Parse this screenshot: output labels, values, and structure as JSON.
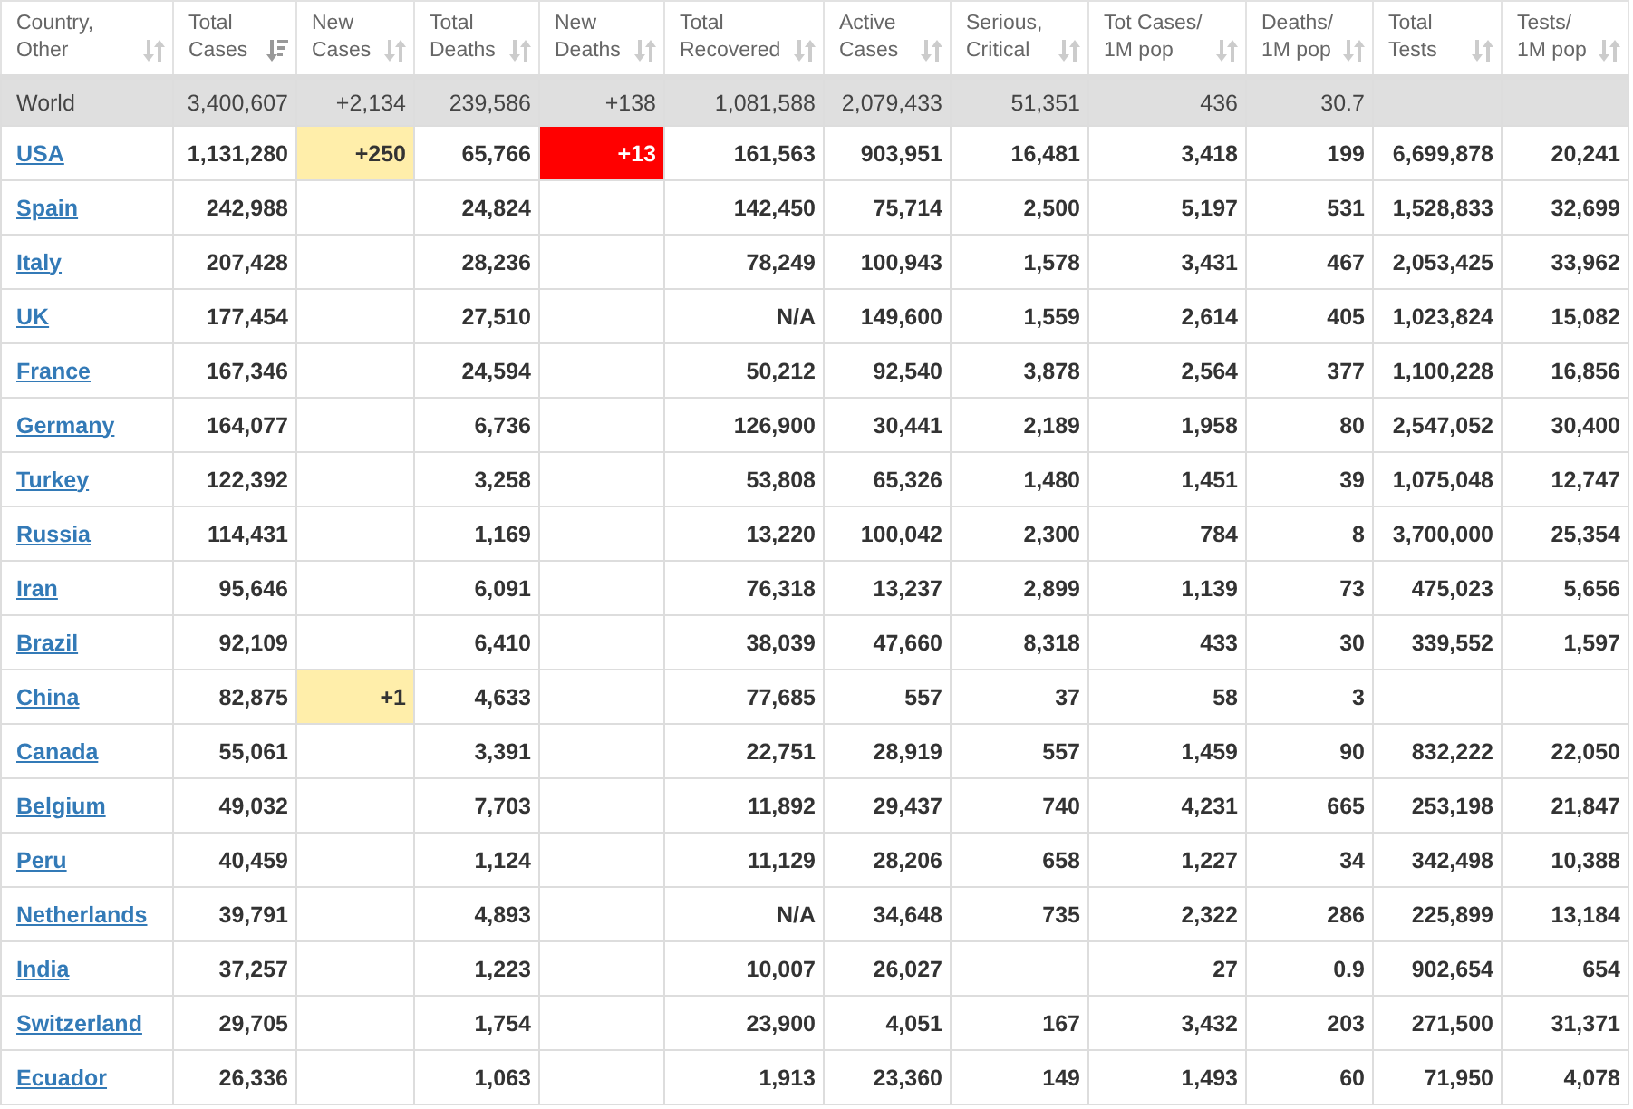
{
  "columns": [
    {
      "label": "Country,\nOther",
      "sorted": false
    },
    {
      "label": "Total\nCases",
      "sorted": true
    },
    {
      "label": "New\nCases",
      "sorted": false
    },
    {
      "label": "Total\nDeaths",
      "sorted": false
    },
    {
      "label": "New\nDeaths",
      "sorted": false
    },
    {
      "label": "Total\nRecovered",
      "sorted": false
    },
    {
      "label": "Active\nCases",
      "sorted": false
    },
    {
      "label": "Serious,\nCritical",
      "sorted": false
    },
    {
      "label": "Tot Cases/\n1M pop",
      "sorted": false
    },
    {
      "label": "Deaths/\n1M pop",
      "sorted": false
    },
    {
      "label": "Total\nTests",
      "sorted": false
    },
    {
      "label": "Tests/\n1M pop",
      "sorted": false
    }
  ],
  "world": {
    "country": "World",
    "total_cases": "3,400,607",
    "new_cases": "+2,134",
    "total_deaths": "239,586",
    "new_deaths": "+138",
    "total_recovered": "1,081,588",
    "active_cases": "2,079,433",
    "serious_critical": "51,351",
    "cases_per_1m": "436",
    "deaths_per_1m": "30.7"
  },
  "rows": [
    {
      "country": "USA",
      "total_cases": "1,131,280",
      "new_cases": "+250",
      "total_deaths": "65,766",
      "new_deaths": "+13",
      "total_recovered": "161,563",
      "active_cases": "903,951",
      "serious_critical": "16,481",
      "cases_per_1m": "3,418",
      "deaths_per_1m": "199",
      "total_tests": "6,699,878",
      "tests_per_1m": "20,241"
    },
    {
      "country": "Spain",
      "total_cases": "242,988",
      "total_deaths": "24,824",
      "total_recovered": "142,450",
      "active_cases": "75,714",
      "serious_critical": "2,500",
      "cases_per_1m": "5,197",
      "deaths_per_1m": "531",
      "total_tests": "1,528,833",
      "tests_per_1m": "32,699"
    },
    {
      "country": "Italy",
      "total_cases": "207,428",
      "total_deaths": "28,236",
      "total_recovered": "78,249",
      "active_cases": "100,943",
      "serious_critical": "1,578",
      "cases_per_1m": "3,431",
      "deaths_per_1m": "467",
      "total_tests": "2,053,425",
      "tests_per_1m": "33,962"
    },
    {
      "country": "UK",
      "total_cases": "177,454",
      "total_deaths": "27,510",
      "total_recovered": "N/A",
      "active_cases": "149,600",
      "serious_critical": "1,559",
      "cases_per_1m": "2,614",
      "deaths_per_1m": "405",
      "total_tests": "1,023,824",
      "tests_per_1m": "15,082"
    },
    {
      "country": "France",
      "total_cases": "167,346",
      "total_deaths": "24,594",
      "total_recovered": "50,212",
      "active_cases": "92,540",
      "serious_critical": "3,878",
      "cases_per_1m": "2,564",
      "deaths_per_1m": "377",
      "total_tests": "1,100,228",
      "tests_per_1m": "16,856"
    },
    {
      "country": "Germany",
      "total_cases": "164,077",
      "total_deaths": "6,736",
      "total_recovered": "126,900",
      "active_cases": "30,441",
      "serious_critical": "2,189",
      "cases_per_1m": "1,958",
      "deaths_per_1m": "80",
      "total_tests": "2,547,052",
      "tests_per_1m": "30,400"
    },
    {
      "country": "Turkey",
      "total_cases": "122,392",
      "total_deaths": "3,258",
      "total_recovered": "53,808",
      "active_cases": "65,326",
      "serious_critical": "1,480",
      "cases_per_1m": "1,451",
      "deaths_per_1m": "39",
      "total_tests": "1,075,048",
      "tests_per_1m": "12,747"
    },
    {
      "country": "Russia",
      "total_cases": "114,431",
      "total_deaths": "1,169",
      "total_recovered": "13,220",
      "active_cases": "100,042",
      "serious_critical": "2,300",
      "cases_per_1m": "784",
      "deaths_per_1m": "8",
      "total_tests": "3,700,000",
      "tests_per_1m": "25,354"
    },
    {
      "country": "Iran",
      "total_cases": "95,646",
      "total_deaths": "6,091",
      "total_recovered": "76,318",
      "active_cases": "13,237",
      "serious_critical": "2,899",
      "cases_per_1m": "1,139",
      "deaths_per_1m": "73",
      "total_tests": "475,023",
      "tests_per_1m": "5,656"
    },
    {
      "country": "Brazil",
      "total_cases": "92,109",
      "total_deaths": "6,410",
      "total_recovered": "38,039",
      "active_cases": "47,660",
      "serious_critical": "8,318",
      "cases_per_1m": "433",
      "deaths_per_1m": "30",
      "total_tests": "339,552",
      "tests_per_1m": "1,597"
    },
    {
      "country": "China",
      "total_cases": "82,875",
      "new_cases": "+1",
      "total_deaths": "4,633",
      "total_recovered": "77,685",
      "active_cases": "557",
      "serious_critical": "37",
      "cases_per_1m": "58",
      "deaths_per_1m": "3"
    },
    {
      "country": "Canada",
      "total_cases": "55,061",
      "total_deaths": "3,391",
      "total_recovered": "22,751",
      "active_cases": "28,919",
      "serious_critical": "557",
      "cases_per_1m": "1,459",
      "deaths_per_1m": "90",
      "total_tests": "832,222",
      "tests_per_1m": "22,050"
    },
    {
      "country": "Belgium",
      "total_cases": "49,032",
      "total_deaths": "7,703",
      "total_recovered": "11,892",
      "active_cases": "29,437",
      "serious_critical": "740",
      "cases_per_1m": "4,231",
      "deaths_per_1m": "665",
      "total_tests": "253,198",
      "tests_per_1m": "21,847"
    },
    {
      "country": "Peru",
      "total_cases": "40,459",
      "total_deaths": "1,124",
      "total_recovered": "11,129",
      "active_cases": "28,206",
      "serious_critical": "658",
      "cases_per_1m": "1,227",
      "deaths_per_1m": "34",
      "total_tests": "342,498",
      "tests_per_1m": "10,388"
    },
    {
      "country": "Netherlands",
      "total_cases": "39,791",
      "total_deaths": "4,893",
      "total_recovered": "N/A",
      "active_cases": "34,648",
      "serious_critical": "735",
      "cases_per_1m": "2,322",
      "deaths_per_1m": "286",
      "total_tests": "225,899",
      "tests_per_1m": "13,184"
    },
    {
      "country": "India",
      "total_cases": "37,257",
      "total_deaths": "1,223",
      "total_recovered": "10,007",
      "active_cases": "26,027",
      "cases_per_1m": "27",
      "deaths_per_1m": "0.9",
      "total_tests": "902,654",
      "tests_per_1m": "654"
    },
    {
      "country": "Switzerland",
      "total_cases": "29,705",
      "total_deaths": "1,754",
      "total_recovered": "23,900",
      "active_cases": "4,051",
      "serious_critical": "167",
      "cases_per_1m": "3,432",
      "deaths_per_1m": "203",
      "total_tests": "271,500",
      "tests_per_1m": "31,371"
    },
    {
      "country": "Ecuador",
      "total_cases": "26,336",
      "total_deaths": "1,063",
      "total_recovered": "1,913",
      "active_cases": "23,360",
      "serious_critical": "149",
      "cases_per_1m": "1,493",
      "deaths_per_1m": "60",
      "total_tests": "71,950",
      "tests_per_1m": "4,078"
    }
  ]
}
